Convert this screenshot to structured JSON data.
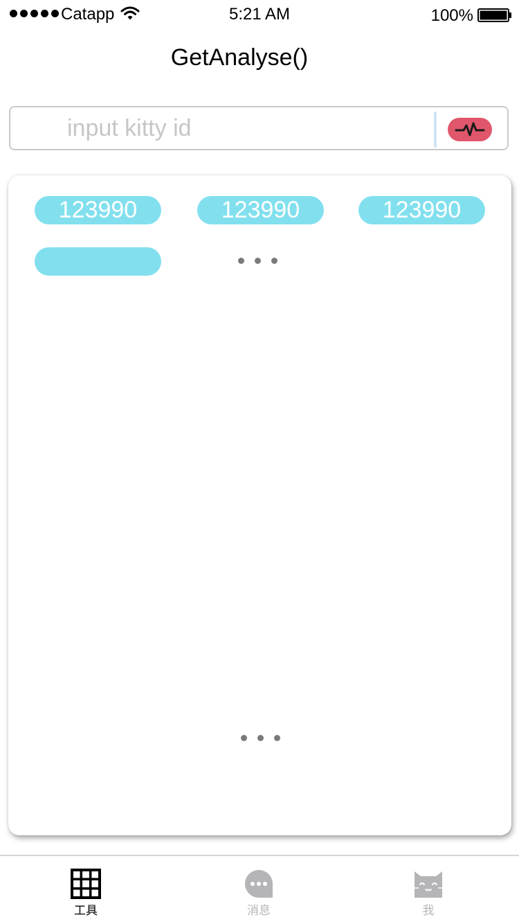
{
  "status_bar": {
    "carrier": "Catapp",
    "time": "5:21 AM",
    "battery": "100%"
  },
  "header": {
    "title": "GetAnalyse()"
  },
  "search": {
    "placeholder": "input kitty id",
    "value": "",
    "button_icon": "pulse-icon",
    "button_color": "#e0566b"
  },
  "results": {
    "chips": [
      "123990",
      "123990",
      "123990",
      ""
    ],
    "chip_color": "#82e0ee",
    "more_indicator": "...",
    "loading_indicator": "..."
  },
  "tab_bar": {
    "items": [
      {
        "label": "工具",
        "icon": "grid-icon",
        "active": true
      },
      {
        "label": "消息",
        "icon": "message-icon",
        "active": false
      },
      {
        "label": "我",
        "icon": "cat-icon",
        "active": false
      }
    ],
    "active_color": "#000000",
    "inactive_color": "#b5b5b8"
  }
}
